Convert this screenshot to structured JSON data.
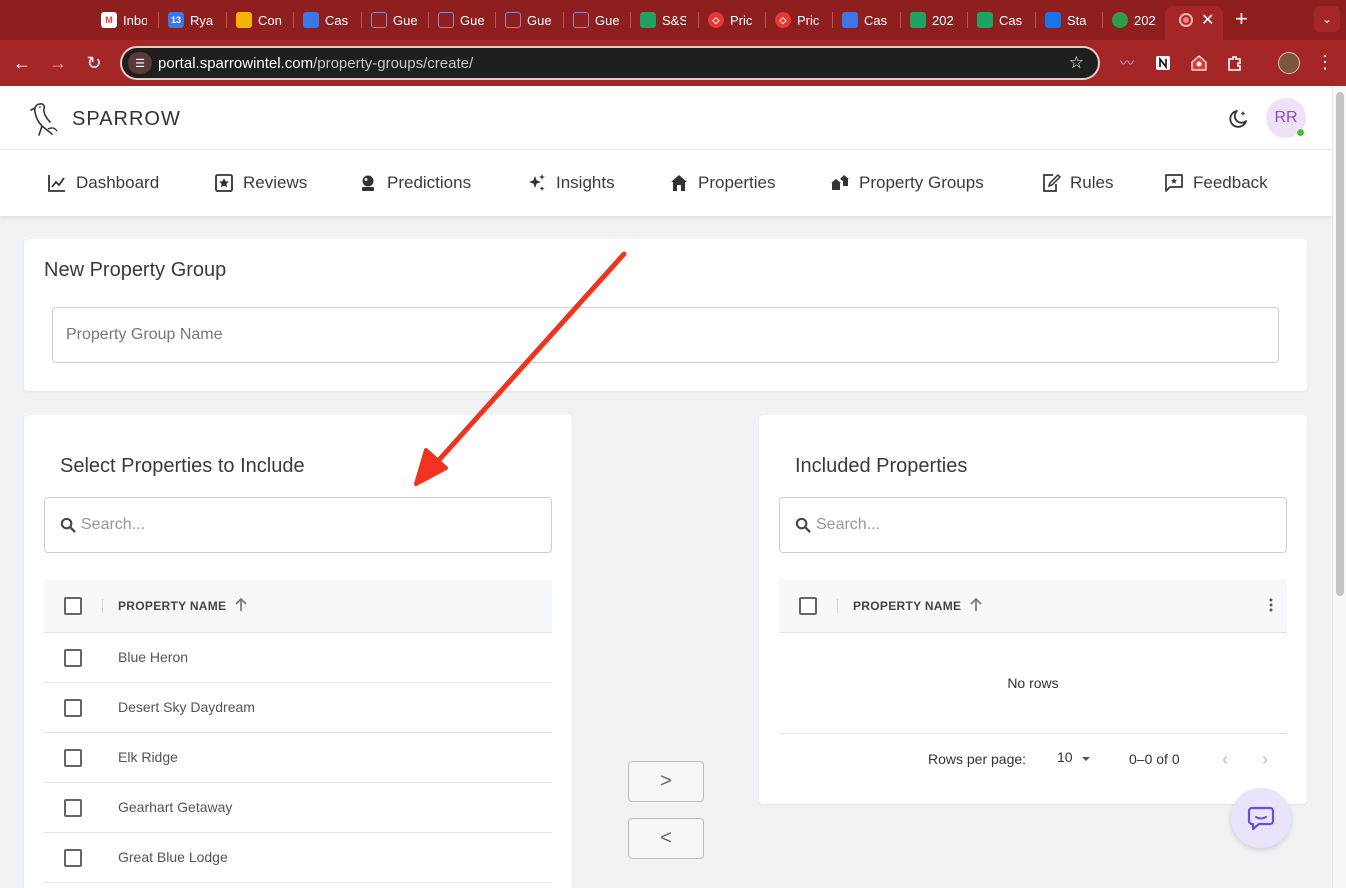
{
  "browser": {
    "tabs": [
      {
        "title": "Inbo",
        "icon": "gmail-icon",
        "color": "#ffffff"
      },
      {
        "title": "Rya",
        "icon": "calendar-icon",
        "color": "#3b78e7"
      },
      {
        "title": "Con",
        "icon": "drive-icon",
        "color": "#f4b400"
      },
      {
        "title": "Cas",
        "icon": "docs-icon",
        "color": "#3b78e7"
      },
      {
        "title": "Gue",
        "icon": "house-icon",
        "color": "#6a5ea8"
      },
      {
        "title": "Gue",
        "icon": "house-icon",
        "color": "#6a5ea8"
      },
      {
        "title": "Gue",
        "icon": "house-icon",
        "color": "#6a5ea8"
      },
      {
        "title": "Gue",
        "icon": "house-icon",
        "color": "#6a5ea8"
      },
      {
        "title": "S&S",
        "icon": "sheets-icon",
        "color": "#1ea362"
      },
      {
        "title": "Pric",
        "icon": "pricelabs-icon",
        "color": "#e53935"
      },
      {
        "title": "Pric",
        "icon": "pricelabs-icon",
        "color": "#e53935"
      },
      {
        "title": "Cas",
        "icon": "docs-icon",
        "color": "#3b78e7"
      },
      {
        "title": "202",
        "icon": "sheets-icon",
        "color": "#1ea362"
      },
      {
        "title": "Cas",
        "icon": "sheets-icon",
        "color": "#1ea362"
      },
      {
        "title": "Sta",
        "icon": "stats-icon",
        "color": "#1a73e8"
      },
      {
        "title": "202",
        "icon": "leaf-icon",
        "color": "#2e9d4a"
      }
    ],
    "active_tab_icon": "sparrow-favicon",
    "calendar_badge": "13",
    "url_host": "portal.sparrowintel.com",
    "url_path": "/property-groups/create/",
    "theme_color": "#a52626"
  },
  "app": {
    "brand": "SPARROW",
    "user_initials": "RR",
    "nav": [
      {
        "label": "Dashboard",
        "icon": "chart-line-icon"
      },
      {
        "label": "Reviews",
        "icon": "star-box-icon"
      },
      {
        "label": "Predictions",
        "icon": "crystal-ball-icon"
      },
      {
        "label": "Insights",
        "icon": "sparkles-icon"
      },
      {
        "label": "Properties",
        "icon": "home-icon"
      },
      {
        "label": "Property Groups",
        "icon": "houses-icon"
      },
      {
        "label": "Rules",
        "icon": "edit-rules-icon"
      },
      {
        "label": "Feedback",
        "icon": "feedback-icon"
      }
    ]
  },
  "form": {
    "title": "New Property Group",
    "name_placeholder": "Property Group Name",
    "name_value": ""
  },
  "available": {
    "title": "Select Properties to Include",
    "search_placeholder": "Search...",
    "column": "PROPERTY NAME",
    "rows": [
      "Blue Heron",
      "Desert Sky Daydream",
      "Elk Ridge",
      "Gearhart Getaway",
      "Great Blue Lodge"
    ]
  },
  "included": {
    "title": "Included Properties",
    "search_placeholder": "Search...",
    "column": "PROPERTY NAME",
    "empty_text": "No rows",
    "rows_per_page_label": "Rows per page:",
    "rows_per_page": "10",
    "range_text": "0–0 of 0"
  },
  "transfer": {
    "add_label": ">",
    "remove_label": "<"
  },
  "annotation": {
    "type": "red-arrow",
    "color": "#f0321e",
    "points_to": "search-available-input"
  }
}
